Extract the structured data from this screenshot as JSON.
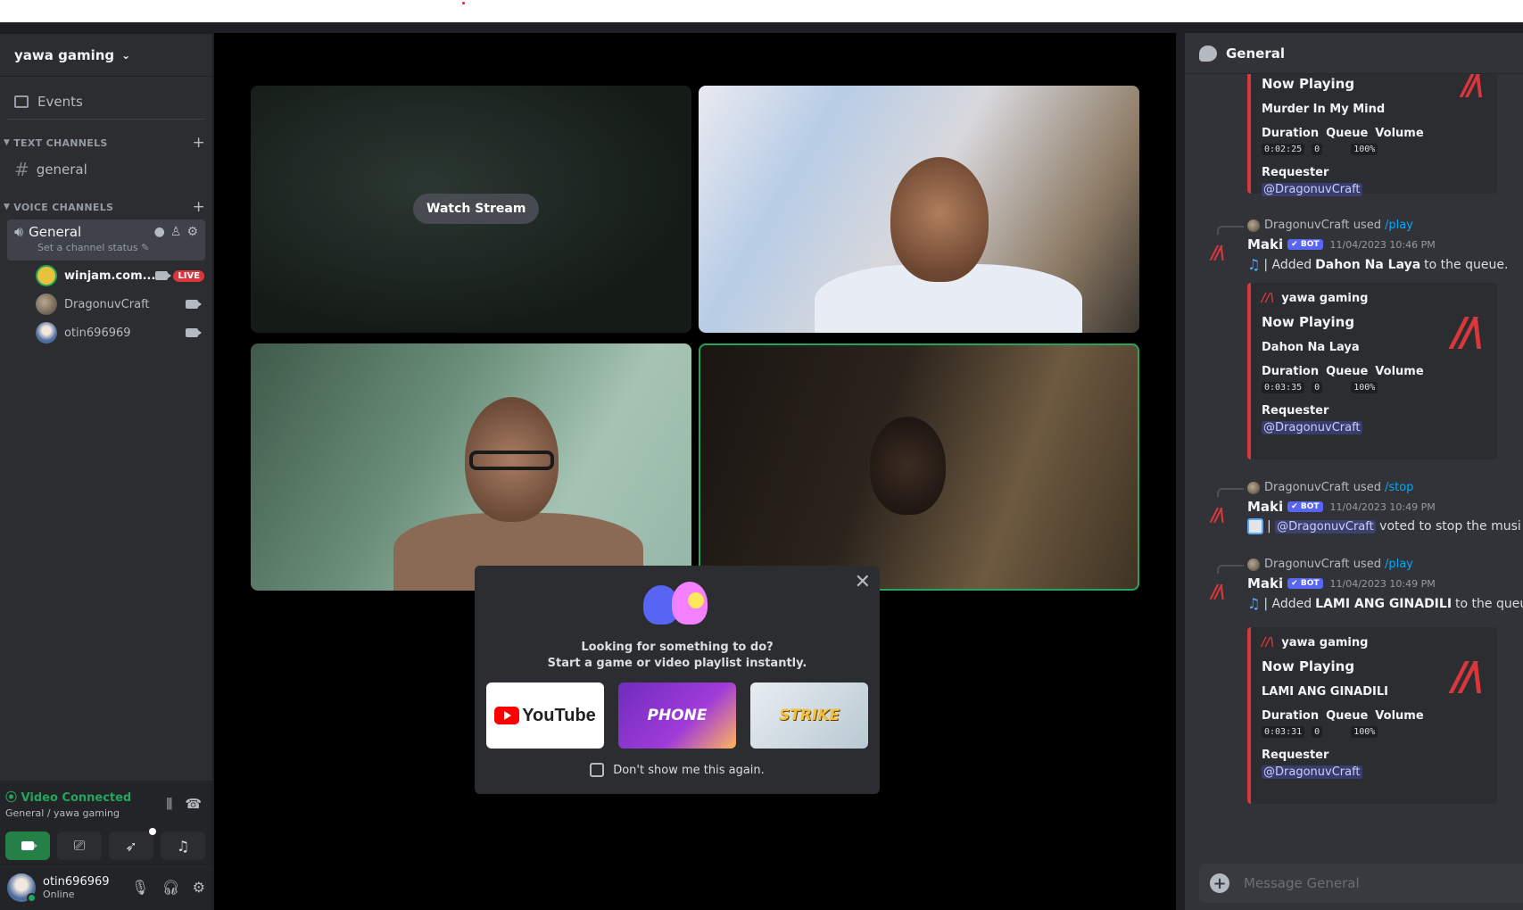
{
  "sidebar": {
    "server_name": "yawa gaming",
    "events_label": "Events",
    "text_category": "TEXT CHANNELS",
    "text_channels": [
      {
        "name": "general"
      }
    ],
    "voice_category": "VOICE CHANNELS",
    "voice_channel": {
      "name": "General",
      "status": "Set a channel status"
    },
    "voice_users": [
      {
        "name": "winjam.com...",
        "live": "LIVE"
      },
      {
        "name": "DragonuvCraft"
      },
      {
        "name": "otin696969"
      }
    ]
  },
  "voice_panel": {
    "title": "Video Connected",
    "subtitle": "General / yawa gaming"
  },
  "user_panel": {
    "username": "otin696969",
    "status": "Online"
  },
  "stage": {
    "watch_stream": "Watch Stream"
  },
  "activity": {
    "line1": "Looking for something to do?",
    "line2": "Start a game or video playlist instantly.",
    "youtube": "YouTube",
    "gartic": "PHONE",
    "krunker": "STRIKE",
    "dont_show": "Don't show me this again."
  },
  "chat": {
    "channel": "General",
    "input_placeholder": "Message General",
    "embed_top": {
      "title": "Now Playing",
      "song": "Murder In My Mind",
      "duration": "0:02:25",
      "queue": "0",
      "volume": "100%",
      "requester": "@DragonuvCraft"
    },
    "labels": {
      "duration": "Duration",
      "queue": "Queue",
      "volume": "Volume",
      "requester": "Requester",
      "used": "used",
      "bot": "BOT"
    },
    "messages": [
      {
        "reply_user": "DragonuvCraft",
        "command": "/play",
        "author": "Maki",
        "time": "11/04/2023 10:46 PM",
        "pre": "| Added",
        "bold": "Dahon Na Laya",
        "post": "to the queue.",
        "embed": {
          "author": "yawa gaming",
          "title": "Now Playing",
          "song": "Dahon Na Laya",
          "duration": "0:03:35",
          "queue": "0",
          "volume": "100%",
          "requester": "@DragonuvCraft"
        }
      },
      {
        "reply_user": "DragonuvCraft",
        "command": "/stop",
        "author": "Maki",
        "time": "11/04/2023 10:49 PM",
        "pre": "|",
        "mention": "@DragonuvCraft",
        "post": "voted to stop the musi"
      },
      {
        "reply_user": "DragonuvCraft",
        "command": "/play",
        "author": "Maki",
        "time": "11/04/2023 10:49 PM",
        "pre": "| Added",
        "bold": "LAMI ANG GINADILI",
        "post": "to the queu",
        "embed": {
          "author": "yawa gaming",
          "title": "Now Playing",
          "song": "LAMI ANG GINADILI",
          "duration": "0:03:31",
          "queue": "0",
          "volume": "100%",
          "requester": "@DragonuvCraft"
        }
      }
    ]
  },
  "colors": {
    "accent_green": "#23a55a",
    "live_red": "#da373c",
    "blurple": "#5865f2"
  }
}
